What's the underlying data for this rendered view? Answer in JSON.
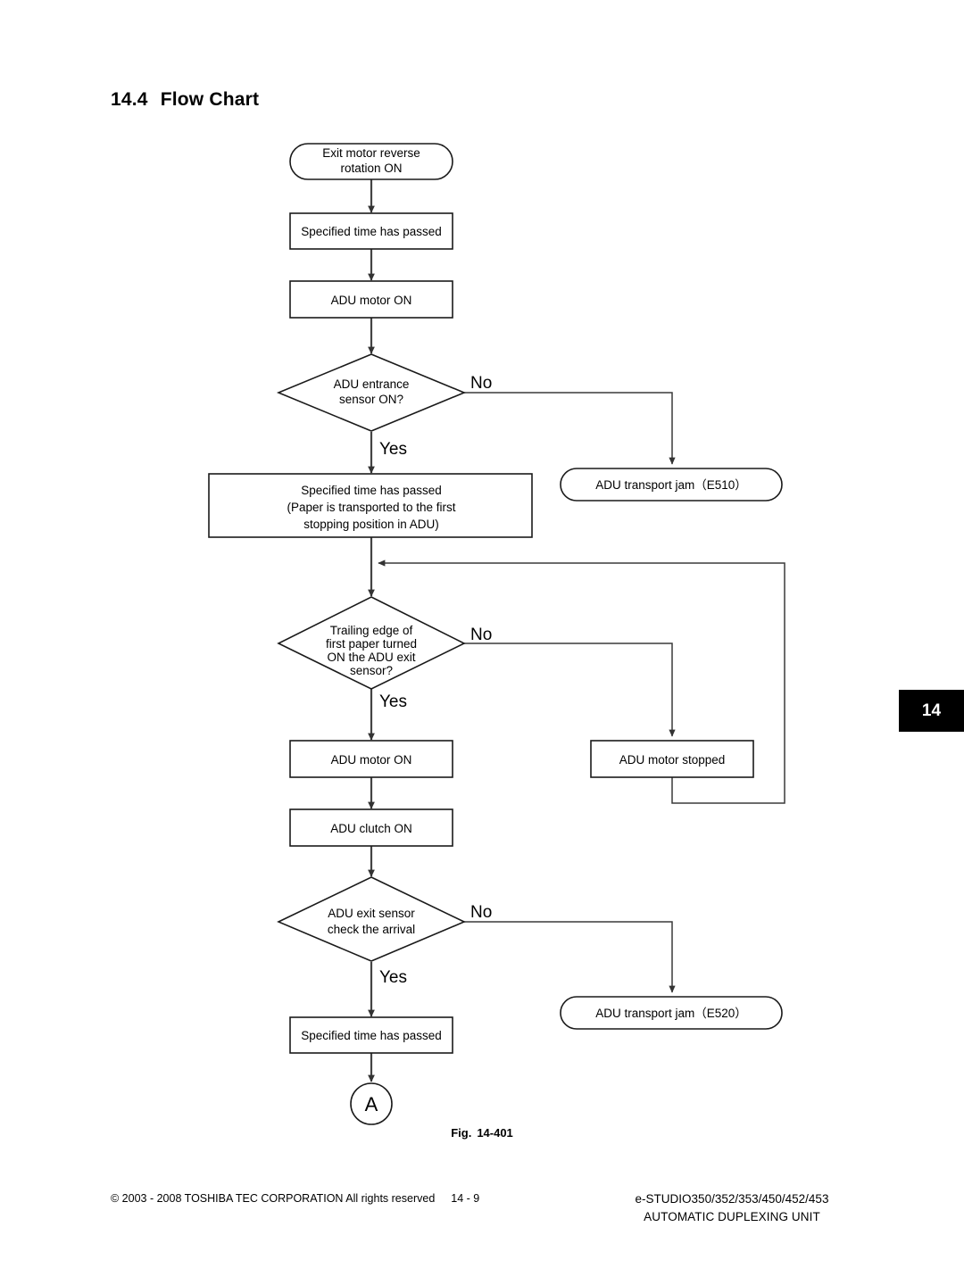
{
  "heading": {
    "number": "14.4",
    "title": "Flow Chart"
  },
  "chapter_tab": {
    "label": "14"
  },
  "figure": {
    "label": "Fig.",
    "number": "14-401"
  },
  "footer": {
    "copyright": "© 2003 - 2008 TOSHIBA TEC CORPORATION All rights reserved",
    "page_number": "14 - 9",
    "model": "e-STUDIO350/352/353/450/452/453",
    "unit": "AUTOMATIC DUPLEXING UNIT"
  },
  "flowchart": {
    "nodes": {
      "start": {
        "line1": "Exit motor reverse",
        "line2": "rotation ON"
      },
      "time1": {
        "line1": "Specified time has passed"
      },
      "adu_motor_on_1": {
        "line1": "ADU motor ON"
      },
      "dec_entrance": {
        "line1": "ADU entrance",
        "line2": "sensor ON?"
      },
      "jam_e510": {
        "line1": "ADU transport jam（E510）"
      },
      "time2": {
        "line1": "Specified time has passed",
        "line2": "(Paper is transported to the first",
        "line3": "stopping position in ADU)"
      },
      "dec_trailing": {
        "line1": "Trailing edge of",
        "line2": "first paper turned",
        "line3": "ON the ADU exit",
        "line4": "sensor?"
      },
      "adu_motor_on_2": {
        "line1": "ADU motor ON"
      },
      "adu_motor_stopped": {
        "line1": "ADU motor stopped"
      },
      "adu_clutch_on": {
        "line1": "ADU clutch ON"
      },
      "dec_exit": {
        "line1": "ADU exit sensor",
        "line2": "check the arrival"
      },
      "jam_e520": {
        "line1": "ADU transport jam（E520）"
      },
      "time3": {
        "line1": "Specified time has passed"
      },
      "connector_a": {
        "label": "A"
      }
    },
    "branch_labels": {
      "entrance_no": "No",
      "entrance_yes": "Yes",
      "trailing_no": "No",
      "trailing_yes": "Yes",
      "exit_no": "No",
      "exit_yes": "Yes"
    }
  },
  "colors": {
    "ink": "#000000",
    "line": "#444444",
    "tab_bg": "#000000",
    "tab_fg": "#ffffff",
    "page_bg": "#ffffff"
  }
}
